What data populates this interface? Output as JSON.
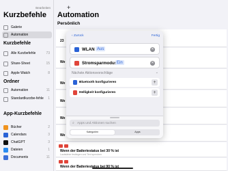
{
  "status_bar": {
    "time": "17:41  Dienstag 14. Okt."
  },
  "sidebar": {
    "title": "Kurzbefehle",
    "edit_label": "Bearbeiten",
    "top_items": [
      {
        "label": "Galerie",
        "icon": "gallery-icon",
        "color": "#8e8e93"
      },
      {
        "label": "Automation",
        "icon": "automation-icon",
        "color": "#8e8e93",
        "active": true
      }
    ],
    "kurzbefehle_header": "Kurzbefehle",
    "kurzbefehle_items": [
      {
        "label": "Alle Kurzbefehle",
        "count": "73",
        "color": "#8e8e93"
      },
      {
        "label": "Share-Sheet",
        "count": "15",
        "color": "#8e8e93"
      },
      {
        "label": "Apple Watch",
        "count": "8",
        "color": "#8e8e93"
      }
    ],
    "ordner_header": "Ordner",
    "ordner_items": [
      {
        "label": "Automation",
        "count": "11",
        "color": "#8e8e93"
      },
      {
        "label": "Standardkurzbe-fehle",
        "count": "1",
        "color": "#8e8e93"
      }
    ],
    "app_header": "App-Kurzbefehle",
    "app_items": [
      {
        "label": "Bücher",
        "count": "2",
        "color": "#f0931e"
      },
      {
        "label": "Calendars",
        "count": "3",
        "color": "#2a62d6"
      },
      {
        "label": "ChatGPT",
        "count": "3",
        "color": "#111111"
      },
      {
        "label": "Dateien",
        "count": "1",
        "color": "#2a8bf0"
      },
      {
        "label": "Documents",
        "count": "11",
        "color": "#3c6fd8"
      }
    ]
  },
  "main": {
    "plus_label": "+",
    "title": "Automation",
    "subtitle": "Persönlich",
    "rows": [
      {
        "text": "23",
        "sub": ""
      },
      {
        "text": "We",
        "sub": ""
      },
      {
        "text": "We",
        "sub": ""
      },
      {
        "text": "We",
        "sub": ""
      },
      {
        "text": "We",
        "sub": ""
      },
      {
        "text": "We",
        "sub": ""
      },
      {
        "text": "Wenn der Batteriestatus bei 30 % ist",
        "sub": "Lautstärke festlegen und Text sprechen"
      },
      {
        "text": "Wenn der Batteriestatus bei 90 % ist",
        "sub": "Lautstärke festlegen und Text sprechen"
      }
    ]
  },
  "panel": {
    "back_label": "Zurück",
    "done_label": "Fertig",
    "actions": [
      {
        "label": "WLAN",
        "token": "Aus",
        "icon": "wifi-icon",
        "color": "#2a62d6"
      },
      {
        "label": "Stromsparmodus",
        "token": "Ein",
        "icon": "battery-icon",
        "color": "#e0453a"
      }
    ],
    "suggestions_header": "Nächste Aktionsvorschläge",
    "suggestions": [
      {
        "label": "Bluetooth konfigurieren",
        "icon": "bluetooth-icon",
        "color": "#2a62d6"
      },
      {
        "label": "Helligkeit konfigurieren",
        "icon": "brightness-icon",
        "color": "#e0453a"
      }
    ],
    "search_placeholder": "Apps und Aktionen suchen",
    "segments": [
      "Kategorien",
      "Apps"
    ]
  }
}
